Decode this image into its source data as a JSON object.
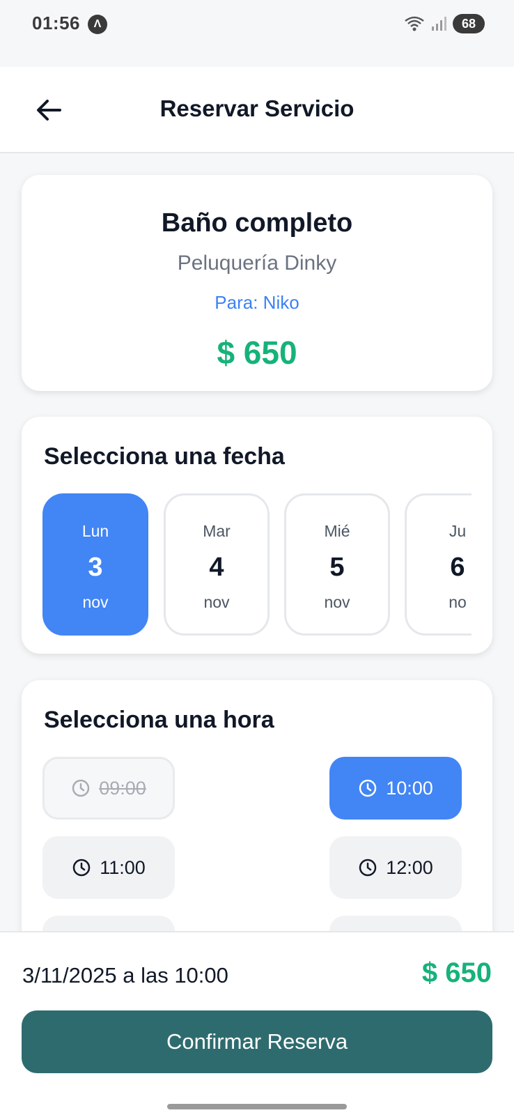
{
  "status_bar": {
    "time": "01:56",
    "app_icon_glyph": "Λ",
    "battery": "68",
    "icons": [
      "wifi-icon",
      "signal-icon",
      "battery-icon"
    ]
  },
  "header": {
    "title": "Reservar Servicio",
    "back_icon": "arrow-left-icon"
  },
  "service": {
    "name": "Baño completo",
    "provider": "Peluquería Dinky",
    "pet": "Para: Niko",
    "price": "$ 650"
  },
  "date_section": {
    "title": "Selecciona una fecha",
    "dates": [
      {
        "dow": "Lun",
        "day": "3",
        "month": "nov",
        "selected": true
      },
      {
        "dow": "Mar",
        "day": "4",
        "month": "nov",
        "selected": false
      },
      {
        "dow": "Mié",
        "day": "5",
        "month": "nov",
        "selected": false
      },
      {
        "dow": "Ju",
        "day": "6",
        "month": "no",
        "selected": false
      }
    ]
  },
  "time_section": {
    "title": "Selecciona una hora",
    "slots": [
      {
        "time": "09:00",
        "state": "disabled"
      },
      {
        "time": "10:00",
        "state": "selected"
      },
      {
        "time": "11:00",
        "state": "available"
      },
      {
        "time": "12:00",
        "state": "available"
      }
    ]
  },
  "summary": {
    "text": "3/11/2025 a las 10:00",
    "price": "$ 650"
  },
  "confirm_button": {
    "label": "Confirmar Reserva"
  },
  "colors": {
    "accent_blue": "#4285f4",
    "price_green": "#16b27a",
    "confirm_teal": "#2e6b6f",
    "pet_link_blue": "#3b82f6"
  }
}
